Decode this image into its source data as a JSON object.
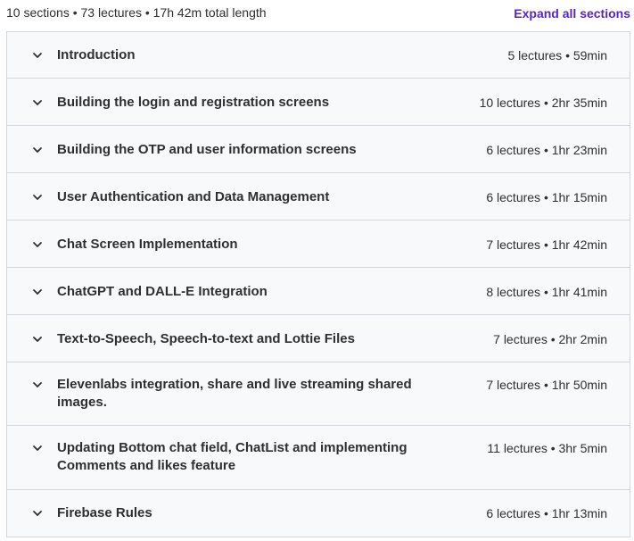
{
  "summary": {
    "text": "10 sections • 73 lectures • 17h 42m total length",
    "expand_label": "Expand all sections"
  },
  "icons": {
    "chevron": "chevron-down-icon"
  },
  "sections": [
    {
      "title": "Introduction",
      "meta": "5 lectures • 59min"
    },
    {
      "title": "Building the login and registration screens",
      "meta": "10 lectures • 2hr 35min"
    },
    {
      "title": "Building the OTP and user information screens",
      "meta": "6 lectures • 1hr 23min"
    },
    {
      "title": "User Authentication and Data Management",
      "meta": "6 lectures • 1hr 15min"
    },
    {
      "title": "Chat Screen Implementation",
      "meta": "7 lectures • 1hr 42min"
    },
    {
      "title": "ChatGPT and DALL-E Integration",
      "meta": "8 lectures • 1hr 41min"
    },
    {
      "title": "Text-to-Speech, Speech-to-text and Lottie Files",
      "meta": "7 lectures • 2hr 2min"
    },
    {
      "title": "Elevenlabs integration, share and live streaming shared images.",
      "meta": "7 lectures • 1hr 50min"
    },
    {
      "title": "Updating Bottom chat field, ChatList and implementing Comments and likes feature",
      "meta": "11 lectures • 3hr 5min"
    },
    {
      "title": "Firebase Rules",
      "meta": "6 lectures • 1hr 13min"
    }
  ]
}
